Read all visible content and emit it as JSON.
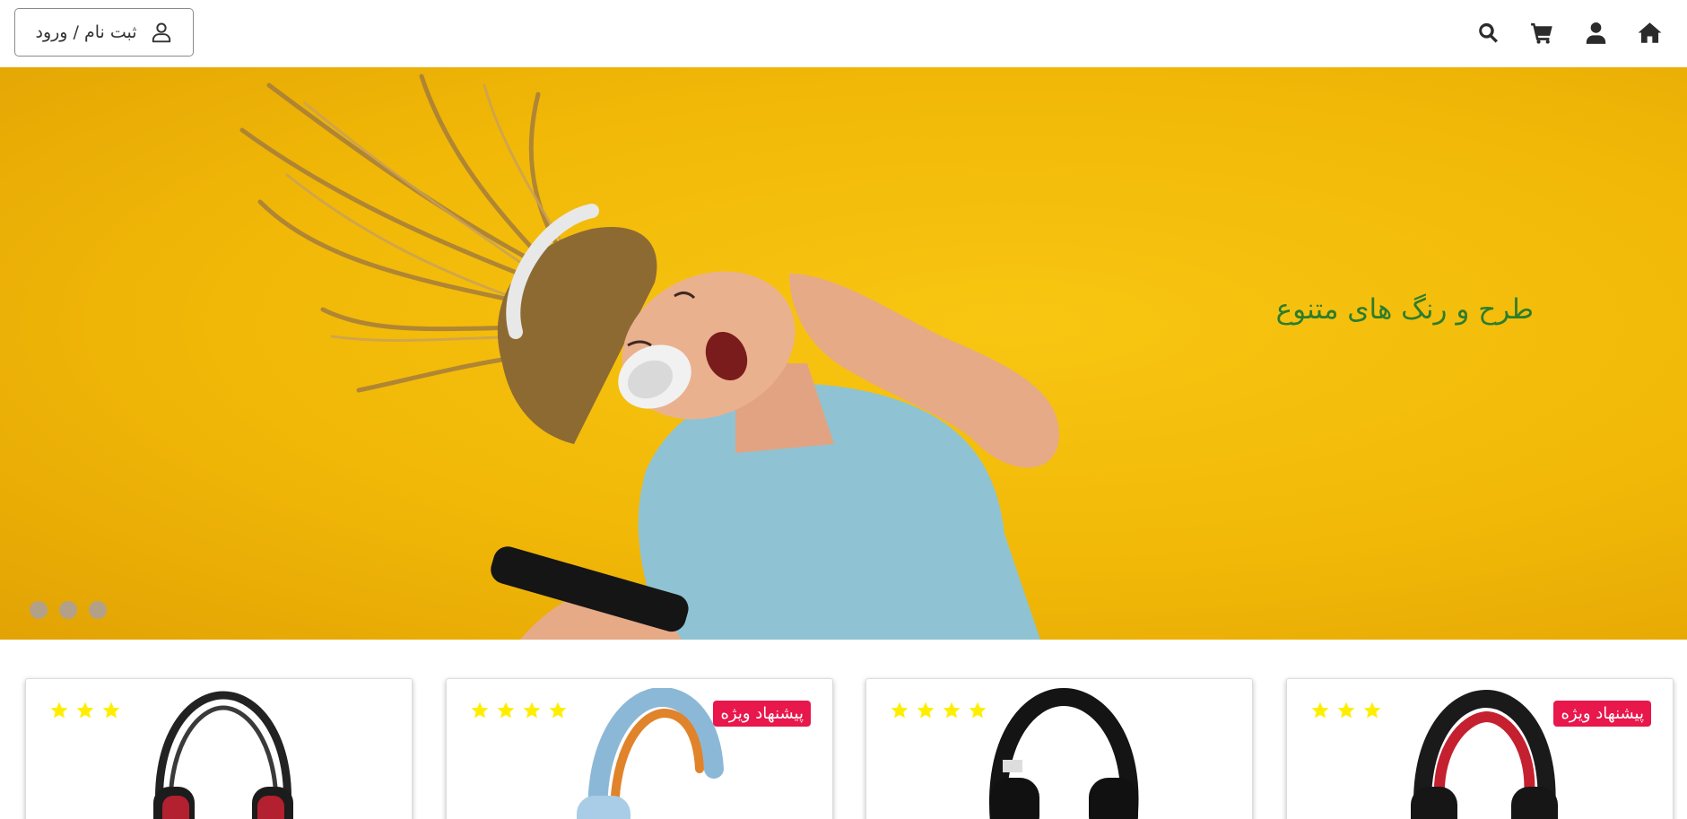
{
  "header": {
    "login_label": "ثبت نام / ورود",
    "nav_icons": [
      "home-icon",
      "user-icon",
      "cart-icon",
      "search-icon"
    ]
  },
  "hero": {
    "caption": "طرح و رنگ های متنوع",
    "caption_color": "#2d7d2d",
    "background_color": "#f4bd09",
    "slide_count": 3
  },
  "products": [
    {
      "stars": 3,
      "badge": "",
      "headphone_color": "black-red"
    },
    {
      "stars": 4,
      "badge": "پیشنهاد ویژه",
      "headphone_color": "blue-orange"
    },
    {
      "stars": 4,
      "badge": "",
      "headphone_color": "black"
    },
    {
      "stars": 3,
      "badge": "پیشنهاد ویژه",
      "headphone_color": "black-red"
    }
  ],
  "colors": {
    "badge": "#e8174c",
    "star": "#ffee00",
    "icons": "#2b2b2b"
  }
}
